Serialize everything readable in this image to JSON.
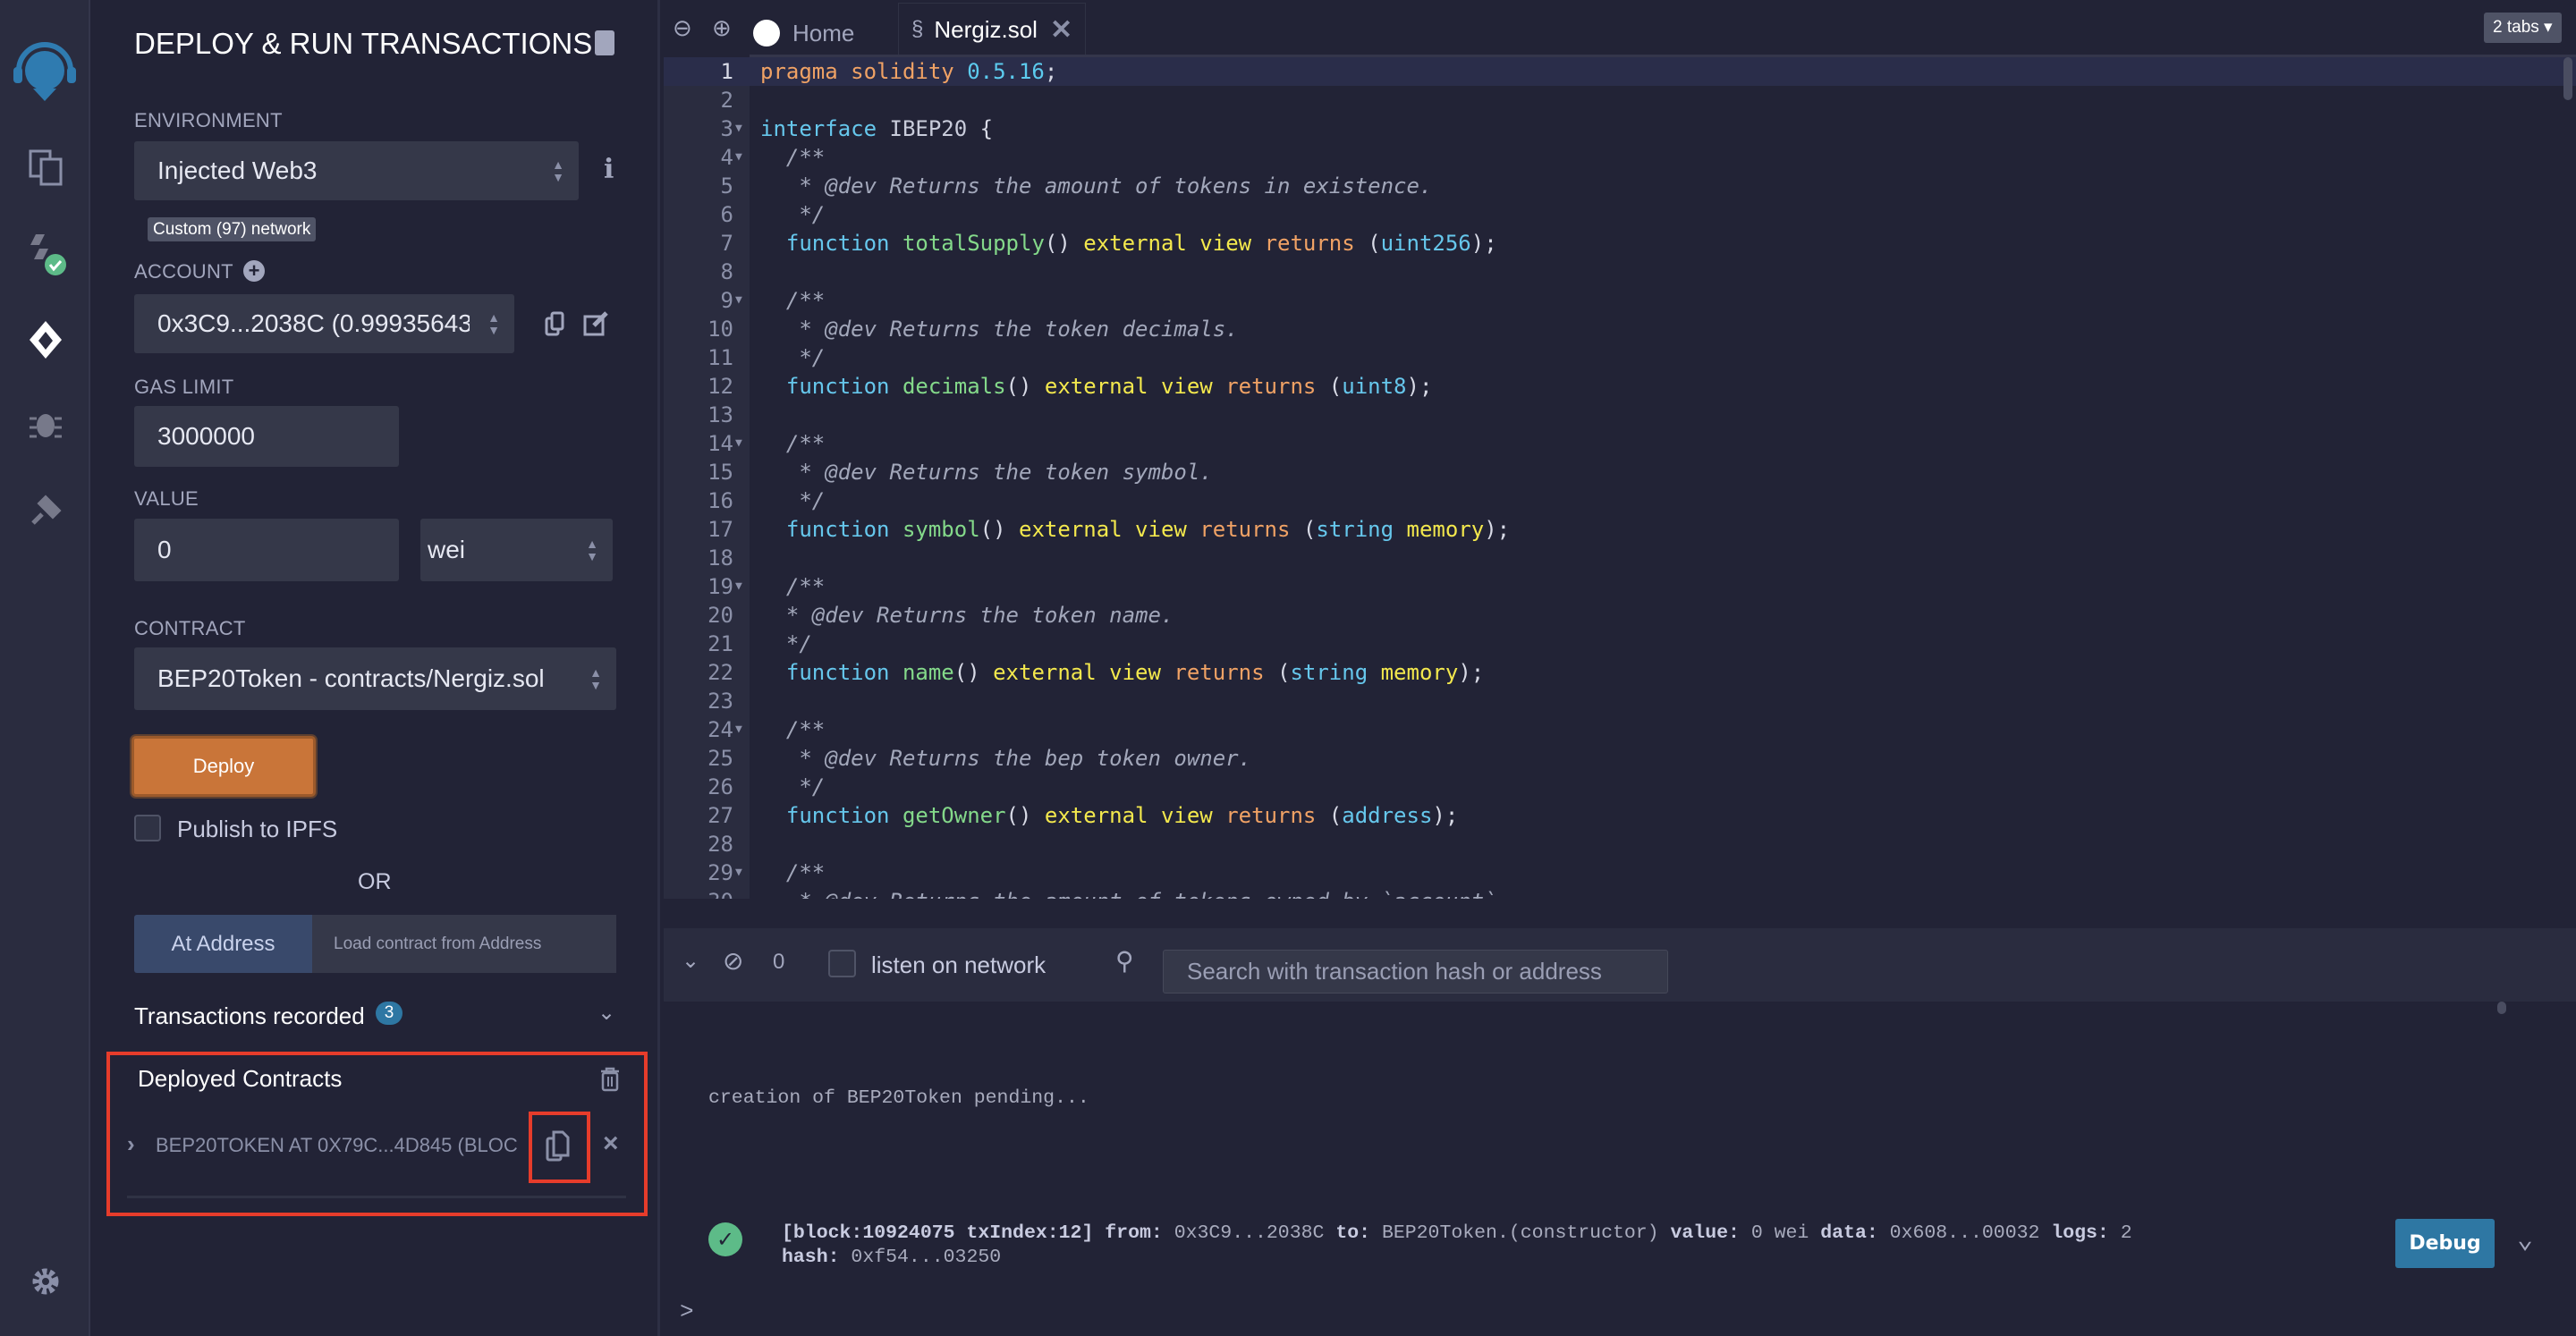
{
  "iconbar": {
    "items": [
      "remix-logo-icon",
      "file-explorer-icon",
      "solidity-compiler-icon",
      "deploy-run-icon",
      "debugger-icon",
      "plugin-manager-icon"
    ],
    "settings": "gear-icon"
  },
  "panel": {
    "title": "DEPLOY & RUN TRANSACTIONS",
    "environment": {
      "label": "ENVIRONMENT",
      "value": "Injected Web3",
      "network_badge": "Custom (97) network"
    },
    "account": {
      "label": "ACCOUNT",
      "value": "0x3C9...2038C (0.99935643"
    },
    "gas_limit": {
      "label": "GAS LIMIT",
      "value": "3000000"
    },
    "value": {
      "label": "VALUE",
      "amount": "0",
      "unit": "wei"
    },
    "contract": {
      "label": "CONTRACT",
      "value": "BEP20Token - contracts/Nergiz.sol"
    },
    "deploy_label": "Deploy",
    "publish_ipfs": "Publish to IPFS",
    "or": "OR",
    "at_address_label": "At Address",
    "at_address_placeholder": "Load contract from Address",
    "transactions_recorded": "Transactions recorded",
    "transactions_count": "3",
    "deployed": {
      "title": "Deployed Contracts",
      "instance": "BEP20TOKEN AT 0X79C...4D845 (BLOCK"
    }
  },
  "colors": {
    "accent_orange": "#c97539",
    "debug_blue": "#2e77a3",
    "success_green": "#5dbb88",
    "highlight_red": "#e63c2b"
  },
  "editor": {
    "tabs": [
      {
        "label": "Home"
      },
      {
        "label": "Nergiz.sol",
        "active": true
      }
    ],
    "tab_count": "2 tabs",
    "folds": [
      3,
      4,
      9,
      14,
      19,
      24,
      29
    ],
    "lines": [
      [
        [
          "orange",
          "pragma solidity "
        ],
        [
          "num",
          "0.5.16"
        ],
        [
          "punct",
          ";"
        ]
      ],
      [],
      [
        [
          "cyan",
          "interface "
        ],
        [
          "ident",
          "IBEP20 "
        ],
        [
          "punct",
          "{"
        ]
      ],
      [
        [
          "comment",
          "  /**"
        ]
      ],
      [
        [
          "comment",
          "   * @dev Returns the amount of tokens in existence."
        ]
      ],
      [
        [
          "comment",
          "   */"
        ]
      ],
      [
        [
          "cyan",
          "  function "
        ],
        [
          "fn",
          "totalSupply"
        ],
        [
          "punct",
          "() "
        ],
        [
          "yellow",
          "external view "
        ],
        [
          "orange",
          "returns "
        ],
        [
          "punct",
          "("
        ],
        [
          "cyan",
          "uint256"
        ],
        [
          "punct",
          ");"
        ]
      ],
      [],
      [
        [
          "comment",
          "  /**"
        ]
      ],
      [
        [
          "comment",
          "   * @dev Returns the token decimals."
        ]
      ],
      [
        [
          "comment",
          "   */"
        ]
      ],
      [
        [
          "cyan",
          "  function "
        ],
        [
          "fn",
          "decimals"
        ],
        [
          "punct",
          "() "
        ],
        [
          "yellow",
          "external view "
        ],
        [
          "orange",
          "returns "
        ],
        [
          "punct",
          "("
        ],
        [
          "cyan",
          "uint8"
        ],
        [
          "punct",
          ");"
        ]
      ],
      [],
      [
        [
          "comment",
          "  /**"
        ]
      ],
      [
        [
          "comment",
          "   * @dev Returns the token symbol."
        ]
      ],
      [
        [
          "comment",
          "   */"
        ]
      ],
      [
        [
          "cyan",
          "  function "
        ],
        [
          "fn",
          "symbol"
        ],
        [
          "punct",
          "() "
        ],
        [
          "yellow",
          "external view "
        ],
        [
          "orange",
          "returns "
        ],
        [
          "punct",
          "("
        ],
        [
          "cyan",
          "string "
        ],
        [
          "yellow",
          "memory"
        ],
        [
          "punct",
          ");"
        ]
      ],
      [],
      [
        [
          "comment",
          "  /**"
        ]
      ],
      [
        [
          "comment",
          "  * @dev Returns the token name."
        ]
      ],
      [
        [
          "comment",
          "  */"
        ]
      ],
      [
        [
          "cyan",
          "  function "
        ],
        [
          "fn",
          "name"
        ],
        [
          "punct",
          "() "
        ],
        [
          "yellow",
          "external view "
        ],
        [
          "orange",
          "returns "
        ],
        [
          "punct",
          "("
        ],
        [
          "cyan",
          "string "
        ],
        [
          "yellow",
          "memory"
        ],
        [
          "punct",
          ");"
        ]
      ],
      [],
      [
        [
          "comment",
          "  /**"
        ]
      ],
      [
        [
          "comment",
          "   * @dev Returns the bep token owner."
        ]
      ],
      [
        [
          "comment",
          "   */"
        ]
      ],
      [
        [
          "cyan",
          "  function "
        ],
        [
          "fn",
          "getOwner"
        ],
        [
          "punct",
          "() "
        ],
        [
          "yellow",
          "external view "
        ],
        [
          "orange",
          "returns "
        ],
        [
          "punct",
          "("
        ],
        [
          "cyan",
          "address"
        ],
        [
          "punct",
          ");"
        ]
      ],
      [],
      [
        [
          "comment",
          "  /**"
        ]
      ],
      [
        [
          "comment",
          "   * @dev Returns the amount of tokens owned by `account`."
        ]
      ]
    ]
  },
  "terminal": {
    "pending_count": "0",
    "listen_label": "listen on network",
    "search_placeholder": "Search with transaction hash or address",
    "pending_msg": "creation of BEP20Token pending...",
    "tx_line1": [
      [
        "b",
        "[block:10924075 txIndex:12] "
      ],
      [
        "b",
        "from: "
      ],
      [
        "n",
        "0x3C9...2038C "
      ],
      [
        "b",
        "to: "
      ],
      [
        "n",
        "BEP20Token.(constructor) "
      ],
      [
        "b",
        "value: "
      ],
      [
        "n",
        "0 wei "
      ],
      [
        "b",
        "data: "
      ],
      [
        "n",
        "0x608...00032 "
      ],
      [
        "b",
        "logs: "
      ],
      [
        "n",
        "2"
      ]
    ],
    "tx_line2": [
      [
        "b",
        "hash: "
      ],
      [
        "n",
        "0xf54...03250"
      ]
    ],
    "debug_label": "Debug",
    "prompt": ">"
  }
}
